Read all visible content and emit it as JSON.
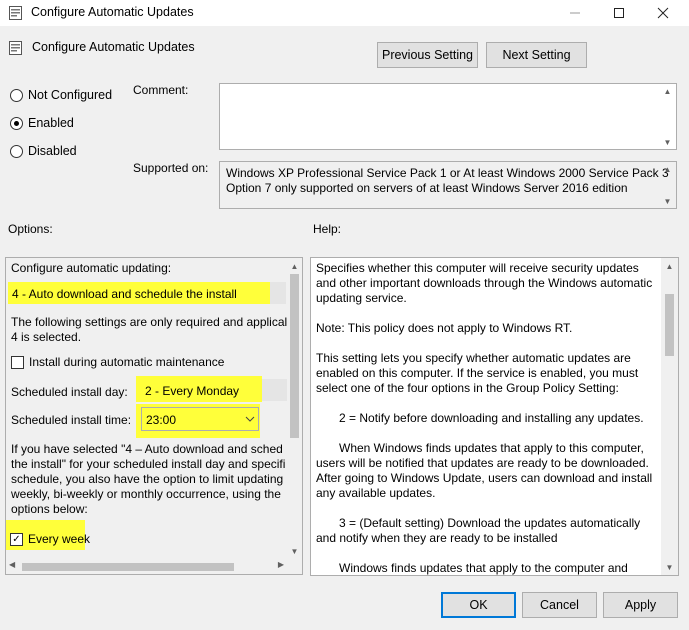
{
  "window": {
    "title": "Configure Automatic Updates"
  },
  "header": {
    "title": "Configure Automatic Updates",
    "prev_button": "Previous Setting",
    "next_button": "Next Setting"
  },
  "state": {
    "options": [
      "Not Configured",
      "Enabled",
      "Disabled"
    ],
    "selected": "Enabled"
  },
  "comment": {
    "label": "Comment:",
    "value": ""
  },
  "supported": {
    "label": "Supported on:",
    "line1": "Windows XP Professional Service Pack 1 or At least Windows 2000 Service Pack 3",
    "line2": "Option 7 only supported on servers of at least Windows Server 2016 edition"
  },
  "options_label": "Options:",
  "help_label": "Help:",
  "options": {
    "configure_label": "Configure automatic updating:",
    "configure_value": "4 - Auto download and schedule the install",
    "note_line1": "The following settings are only required and applical",
    "note_line2": "4 is selected.",
    "maintenance_label": "Install during automatic maintenance",
    "maintenance_checked": false,
    "day_label": "Scheduled install day:",
    "day_value": "2 - Every Monday",
    "time_label": "Scheduled install time:",
    "time_value": "23:00",
    "para_lines": [
      "If you have selected \"4 – Auto download and sched",
      "the install\" for your scheduled install day and specifi",
      "schedule, you also have the option to limit updating",
      "weekly, bi-weekly or monthly occurrence, using the",
      "options below:"
    ],
    "every_week_label": "Every week",
    "every_week_checked": true
  },
  "help": {
    "paragraphs": [
      "Specifies whether this computer will receive security updates and other important downloads through the Windows automatic updating service.",
      "Note: This policy does not apply to Windows RT.",
      "This setting lets you specify whether automatic updates are enabled on this computer. If the service is enabled, you must select one of the four options in the Group Policy Setting:",
      "2 = Notify before downloading and installing any updates.",
      "When Windows finds updates that apply to this computer, users will be notified that updates are ready to be downloaded. After going to Windows Update, users can download and install any available updates.",
      "3 = (Default setting) Download the updates automatically and notify when they are ready to be installed",
      "Windows finds updates that apply to the computer and"
    ]
  },
  "footer": {
    "ok": "OK",
    "cancel": "Cancel",
    "apply": "Apply"
  },
  "colors": {
    "highlight": "#ffff3a",
    "accent": "#0078d7"
  }
}
